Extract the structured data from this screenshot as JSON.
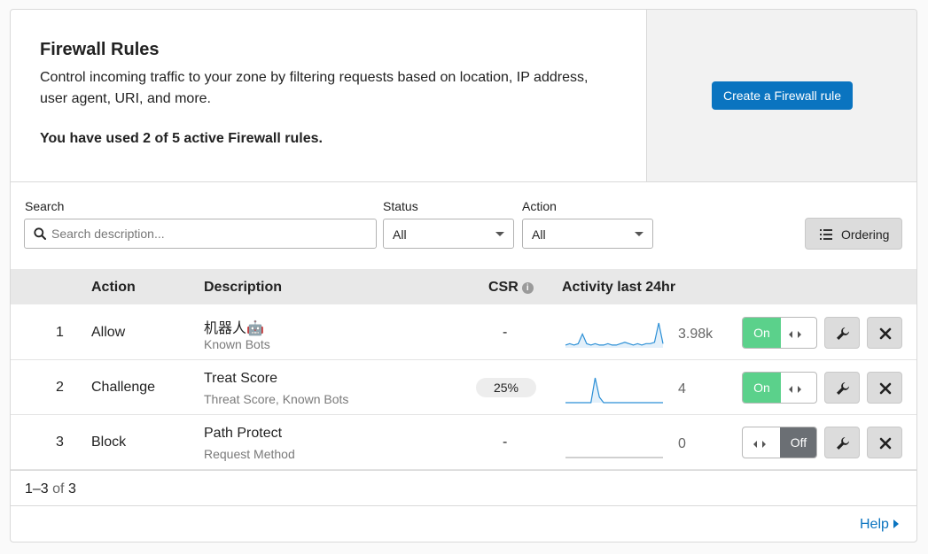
{
  "hero": {
    "title": "Firewall Rules",
    "description": "Control incoming traffic to your zone by filtering requests based on location, IP address, user agent, URI, and more.",
    "usage": "You have used 2 of 5 active Firewall rules.",
    "create_button": "Create a Firewall rule"
  },
  "filters": {
    "search_label": "Search",
    "search_placeholder": "Search description...",
    "status_label": "Status",
    "status_value": "All",
    "action_label": "Action",
    "action_value": "All",
    "ordering_button": "Ordering"
  },
  "table": {
    "headers": {
      "action": "Action",
      "description": "Description",
      "csr": "CSR",
      "activity": "Activity last 24hr"
    },
    "rows": [
      {
        "index": "1",
        "action": "Allow",
        "description": "机器人🤖",
        "sub": "Known Bots",
        "csr": "-",
        "count": "3.98k",
        "enabled": true,
        "toggle_label": "On",
        "spark": [
          2,
          3,
          2,
          3,
          10,
          3,
          2,
          3,
          2,
          2,
          3,
          2,
          2,
          3,
          4,
          3,
          2,
          3,
          2,
          3,
          3,
          4,
          18,
          3
        ]
      },
      {
        "index": "2",
        "action": "Challenge",
        "description": "Treat Score",
        "sub": "Threat Score, Known Bots",
        "csr": "25%",
        "count": "4",
        "enabled": true,
        "toggle_label": "On",
        "spark": [
          0,
          0,
          0,
          0,
          0,
          0,
          0,
          9,
          2,
          0,
          0,
          0,
          0,
          0,
          0,
          0,
          0,
          0,
          0,
          0,
          0,
          0,
          0,
          0
        ]
      },
      {
        "index": "3",
        "action": "Block",
        "description": "Path Protect",
        "sub": "Request Method",
        "csr": "-",
        "count": "0",
        "enabled": false,
        "toggle_label": "Off",
        "spark": [
          0,
          0,
          0,
          0,
          0,
          0,
          0,
          0,
          0,
          0,
          0,
          0,
          0,
          0,
          0,
          0,
          0,
          0,
          0,
          0,
          0,
          0,
          0,
          0
        ]
      }
    ]
  },
  "pager": {
    "range": "1–3",
    "of": "of",
    "total": "3"
  },
  "help": "Help",
  "colors": {
    "primary": "#0a74c0",
    "toggle_on": "#5bd18b",
    "toggle_off": "#6b6f74",
    "spark_line": "#2b8fd6"
  }
}
